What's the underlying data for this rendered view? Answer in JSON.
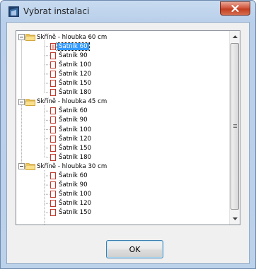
{
  "window": {
    "title": "Vybrat instalaci"
  },
  "tree": {
    "groups": [
      {
        "label": "Skříně - hloubka 60 cm",
        "items": [
          "Šatník  60",
          "Šatník  90",
          "Šatník  100",
          "Šatník  120",
          "Šatník  150",
          "Šatník  180"
        ]
      },
      {
        "label": "Skříně - hloubka 45 cm",
        "items": [
          "Šatník  60",
          "Šatník  90",
          "Šatník  100",
          "Šatník  120",
          "Šatník  150",
          "Šatník  180"
        ]
      },
      {
        "label": "Skříně - hloubka 30 cm",
        "items": [
          "Šatník  60",
          "Šatník  90",
          "Šatník  100",
          "Šatník  120",
          "Šatník  150"
        ]
      }
    ],
    "selected": "Šatník  60"
  },
  "buttons": {
    "ok": "OK"
  },
  "colors": {
    "selection": "#3399ff",
    "doc_icon": "#c0392b",
    "folder": "#f2c94c"
  }
}
